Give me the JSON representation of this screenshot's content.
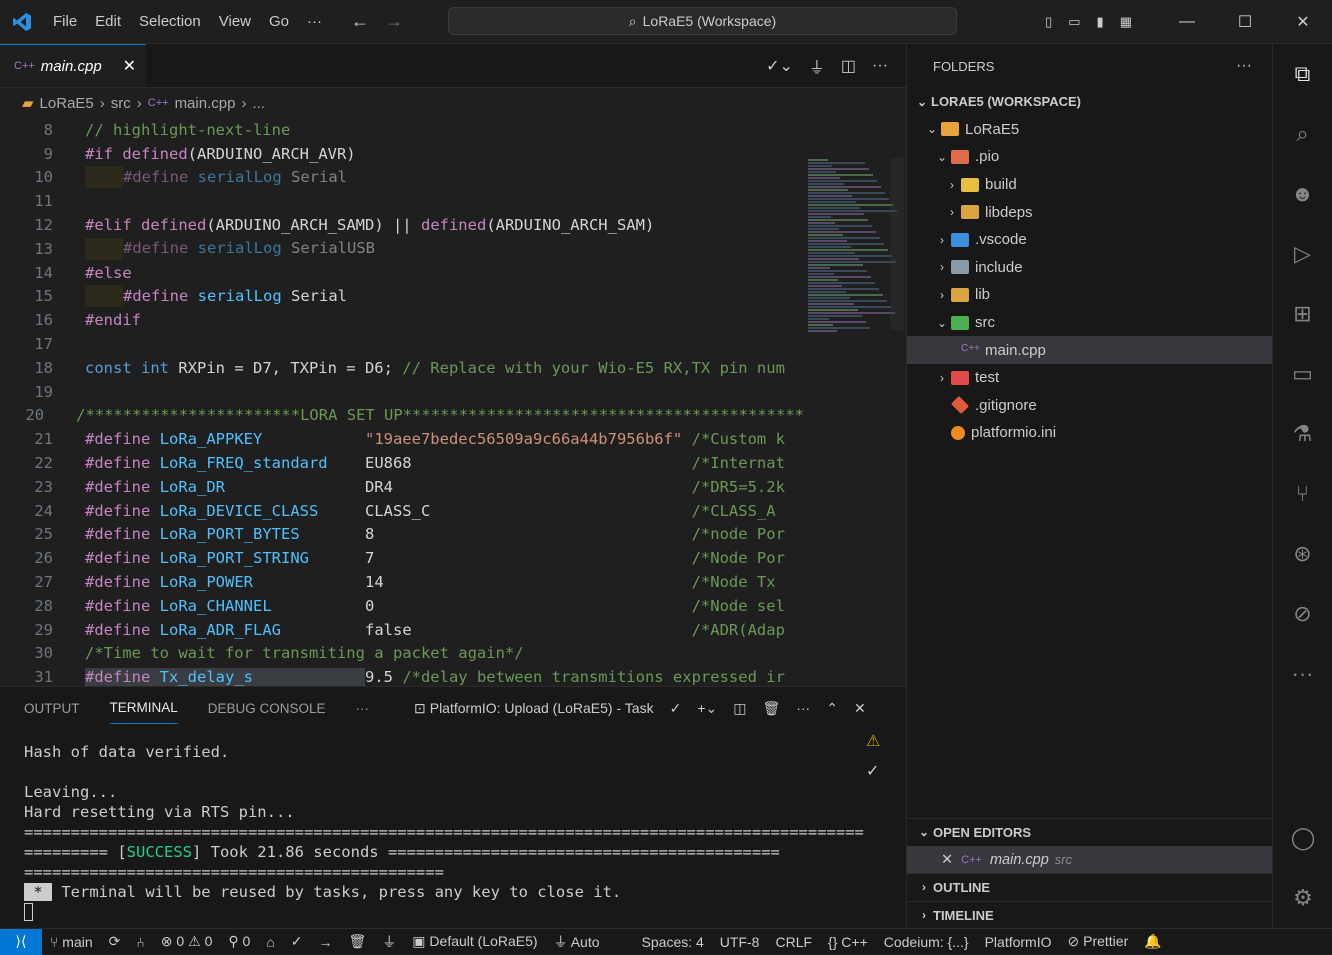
{
  "titlebar": {
    "menu": [
      "File",
      "Edit",
      "Selection",
      "View",
      "Go"
    ],
    "more": "···",
    "command_center": "LoRaE5 (Workspace)"
  },
  "editor": {
    "tab": {
      "label": "main.cpp",
      "icon": "C++"
    },
    "breadcrumb": [
      "LoRaE5",
      "src",
      "main.cpp",
      "..."
    ],
    "lines": [
      {
        "n": "8",
        "t": "// highlight-next-line"
      },
      {
        "n": "9",
        "t": "#if defined(ARDUINO_ARCH_AVR)"
      },
      {
        "n": "10",
        "t": "#define serialLog Serial"
      },
      {
        "n": "11",
        "t": ""
      },
      {
        "n": "12",
        "t": "#elif defined(ARDUINO_ARCH_SAMD) || defined(ARDUINO_ARCH_SAM)"
      },
      {
        "n": "13",
        "t": "#define serialLog SerialUSB"
      },
      {
        "n": "14",
        "t": "#else"
      },
      {
        "n": "15",
        "t": "#define serialLog Serial"
      },
      {
        "n": "16",
        "t": "#endif"
      },
      {
        "n": "17",
        "t": ""
      },
      {
        "n": "18",
        "t": "const int RXPin = D7, TXPin = D6; // Replace with your Wio-E5 RX,TX pin num"
      },
      {
        "n": "19",
        "t": ""
      },
      {
        "n": "20",
        "t": "/***********************LORA SET UP*******************************************"
      },
      {
        "n": "21",
        "t": "#define LoRa_APPKEY           \"19aee7bedec56509a9c66a44b7956b6f\" /*Custom k"
      },
      {
        "n": "22",
        "t": "#define LoRa_FREQ_standard    EU868                              /*Internat"
      },
      {
        "n": "23",
        "t": "#define LoRa_DR               DR4                                /*DR5=5.2k"
      },
      {
        "n": "24",
        "t": "#define LoRa_DEVICE_CLASS     CLASS_C                            /*CLASS_A "
      },
      {
        "n": "25",
        "t": "#define LoRa_PORT_BYTES       8                                  /*node Por"
      },
      {
        "n": "26",
        "t": "#define LoRa_PORT_STRING      7                                  /*Node Por"
      },
      {
        "n": "27",
        "t": "#define LoRa_POWER            14                                 /*Node Tx "
      },
      {
        "n": "28",
        "t": "#define LoRa_CHANNEL          0                                  /*Node sel"
      },
      {
        "n": "29",
        "t": "#define LoRa_ADR_FLAG         false                              /*ADR(Adap"
      },
      {
        "n": "30",
        "t": "/*Time to wait for transmiting a packet again*/"
      },
      {
        "n": "31",
        "t": "#define Tx_delay_s            9.5 /*delay between transmitions expressed ir"
      }
    ]
  },
  "panel": {
    "tabs": [
      "OUTPUT",
      "TERMINAL",
      "DEBUG CONSOLE"
    ],
    "task": "PlatformIO: Upload (LoRaE5) - Task",
    "terminal": [
      "Hash of data verified.",
      "",
      "Leaving...",
      "Hard resetting via RTS pin...",
      "==========================================================================================",
      "========= [SUCCESS] Took 21.86 seconds ==========================================",
      "=============================================",
      " *  Terminal will be reused by tasks, press any key to close it."
    ]
  },
  "sidebar": {
    "header": "FOLDERS",
    "workspace": "LORAE5 (WORKSPACE)",
    "tree": [
      {
        "label": "LoRaE5",
        "depth": 1,
        "chev": "v",
        "color": "#e8a33d"
      },
      {
        "label": ".pio",
        "depth": 2,
        "chev": "v",
        "color": "#e06c4c"
      },
      {
        "label": "build",
        "depth": 3,
        "chev": ">",
        "color": "#e8c03d"
      },
      {
        "label": "libdeps",
        "depth": 3,
        "chev": ">",
        "color": "#d9a441"
      },
      {
        "label": ".vscode",
        "depth": 2,
        "chev": ">",
        "color": "#3d8fe0"
      },
      {
        "label": "include",
        "depth": 2,
        "chev": ">",
        "color": "#8a9aa8"
      },
      {
        "label": "lib",
        "depth": 2,
        "chev": ">",
        "color": "#d9a441"
      },
      {
        "label": "src",
        "depth": 2,
        "chev": "v",
        "color": "#4caf50"
      },
      {
        "label": "main.cpp",
        "depth": 3,
        "chev": "",
        "color": "#a074c4",
        "sel": true
      },
      {
        "label": "test",
        "depth": 2,
        "chev": ">",
        "color": "#e04c4c"
      },
      {
        "label": ".gitignore",
        "depth": 2,
        "chev": "",
        "color": "#e05a3a"
      },
      {
        "label": "platformio.ini",
        "depth": 2,
        "chev": "",
        "color": "#f08a24"
      }
    ],
    "open_editors": "OPEN EDITORS",
    "open_file": "main.cpp",
    "open_file_dir": "src",
    "outline": "OUTLINE",
    "timeline": "TIMELINE"
  },
  "status": {
    "branch": "main",
    "errors": "0",
    "warnings": "0",
    "ports": "0",
    "env": "Default (LoRaE5)",
    "auto": "Auto",
    "spaces": "Spaces: 4",
    "encoding": "UTF-8",
    "eol": "CRLF",
    "lang": "C++",
    "codeium": "Codeium: {...}",
    "pio": "PlatformIO",
    "prettier": "Prettier"
  }
}
